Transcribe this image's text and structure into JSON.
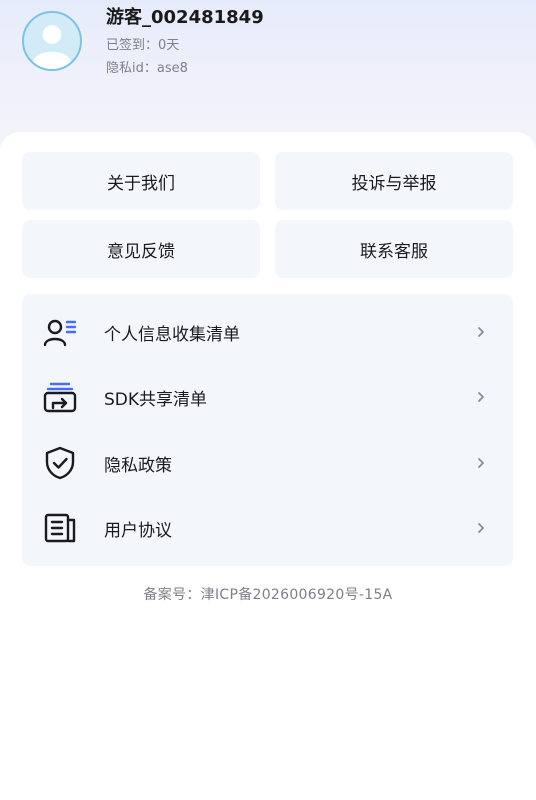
{
  "profile": {
    "nickname": "游客_002481849",
    "signin_text": "已签到：0天",
    "privacy_id_text": "隐私id：ase8",
    "avatar_icon": "user-avatar-icon"
  },
  "grid": {
    "about": "关于我们",
    "complaint": "投诉与举报",
    "feedback": "意见反馈",
    "service": "联系客服"
  },
  "menu": {
    "items": [
      {
        "label": "个人信息收集清单",
        "icon": "user-list-icon"
      },
      {
        "label": "SDK共享清单",
        "icon": "share-stack-icon"
      },
      {
        "label": "隐私政策",
        "icon": "shield-check-icon"
      },
      {
        "label": "用户协议",
        "icon": "document-icon"
      }
    ]
  },
  "footer": {
    "icp": "备案号：津ICP备2026006920号-15A"
  },
  "colors": {
    "accent_avatar_border": "#7bc3e1",
    "tile_background": "#f3f6fb",
    "text_primary": "#1b1b1f",
    "text_secondary": "#7d8089",
    "icon_accent": "#4a6cf4"
  }
}
